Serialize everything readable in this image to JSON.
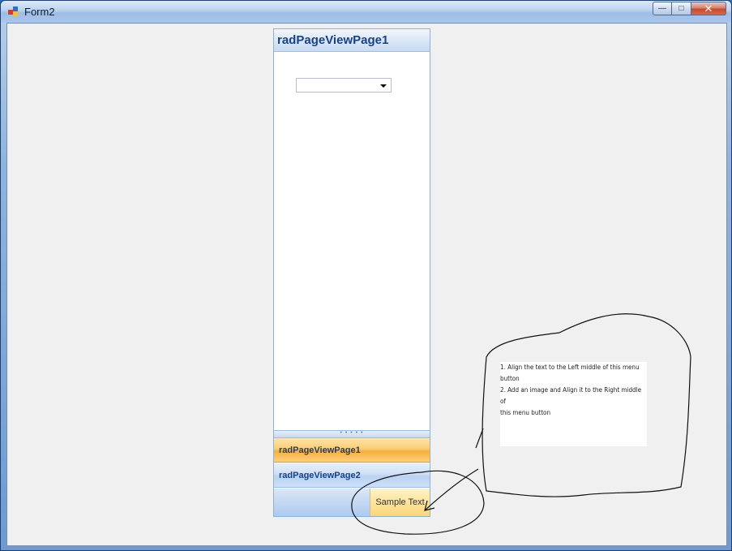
{
  "window": {
    "title": "Form2",
    "buttons": {
      "minimize": "—",
      "maximize": "□",
      "close": "✕"
    }
  },
  "pageview": {
    "page_title": "radPageViewPage1",
    "combo_value": "",
    "splitter_grip": "• • • • •",
    "nav_items": [
      {
        "label": "radPageViewPage1",
        "selected": true
      },
      {
        "label": "radPageViewPage2",
        "selected": false
      }
    ],
    "menu_button_label": "Sample Text"
  },
  "annotation": {
    "lines": [
      "1. Align the text to the Left middle of this menu",
      "button",
      "2.  Add an image and Align it to the Right middle of",
      "this menu button"
    ]
  },
  "colors": {
    "selected_item": "#f8ae3a",
    "header_text": "#15428b",
    "client_bg": "#f0f0f0"
  }
}
